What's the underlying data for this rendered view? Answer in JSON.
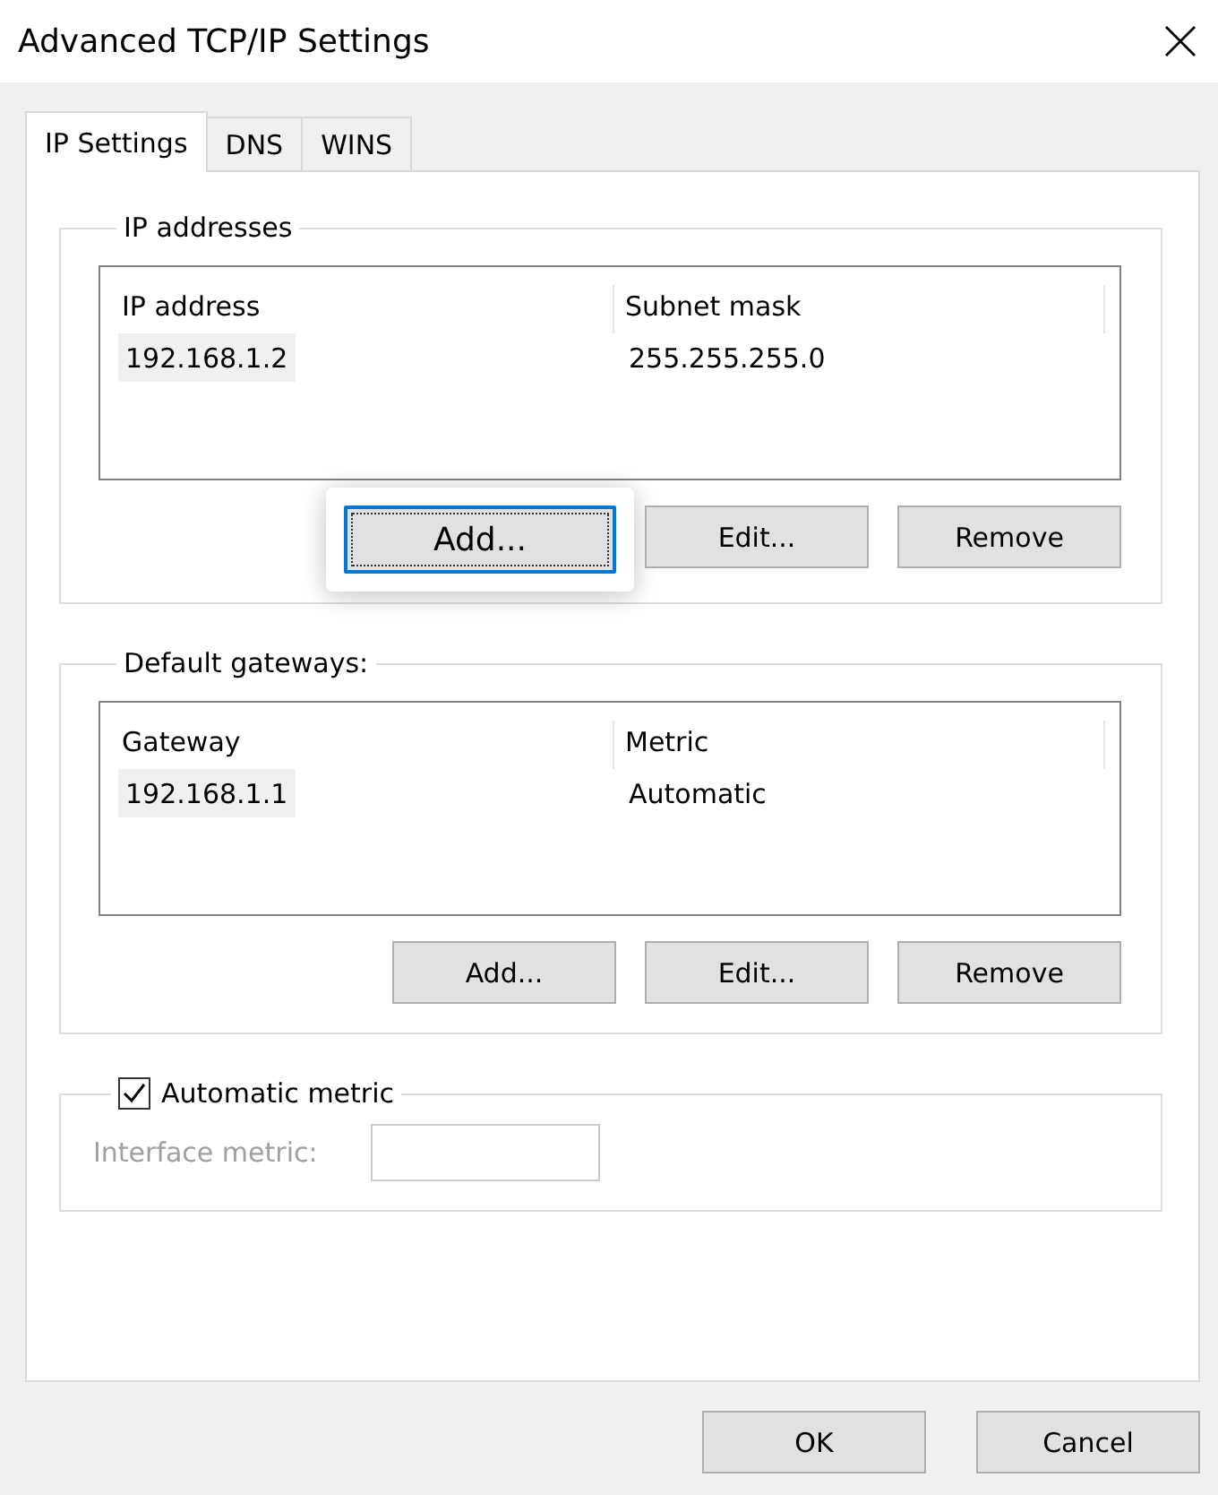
{
  "window": {
    "title": "Advanced TCP/IP Settings"
  },
  "tabs": [
    {
      "label": "IP Settings",
      "selected": true
    },
    {
      "label": "DNS",
      "selected": false
    },
    {
      "label": "WINS",
      "selected": false
    }
  ],
  "ip_addresses": {
    "label": "IP addresses",
    "columns": [
      "IP address",
      "Subnet mask"
    ],
    "rows": [
      {
        "cells": [
          "192.168.1.2",
          "255.255.255.0"
        ],
        "selected": true
      }
    ],
    "buttons": [
      {
        "label": "Add...",
        "focused": true
      },
      {
        "label": "Edit...",
        "focused": false
      },
      {
        "label": "Remove",
        "focused": false
      }
    ]
  },
  "default_gateways": {
    "label": "Default gateways:",
    "columns": [
      "Gateway",
      "Metric"
    ],
    "rows": [
      {
        "cells": [
          "192.168.1.1",
          "Automatic"
        ],
        "selected": true
      }
    ],
    "buttons": [
      {
        "label": "Add...",
        "focused": false
      },
      {
        "label": "Edit...",
        "focused": false
      },
      {
        "label": "Remove",
        "focused": false
      }
    ]
  },
  "automatic_metric": {
    "label": "Automatic metric",
    "checked": true
  },
  "interface_metric": {
    "label": "Interface metric:",
    "disabled": true
  },
  "footer_buttons": [
    {
      "label": "OK"
    },
    {
      "label": "Cancel"
    }
  ]
}
